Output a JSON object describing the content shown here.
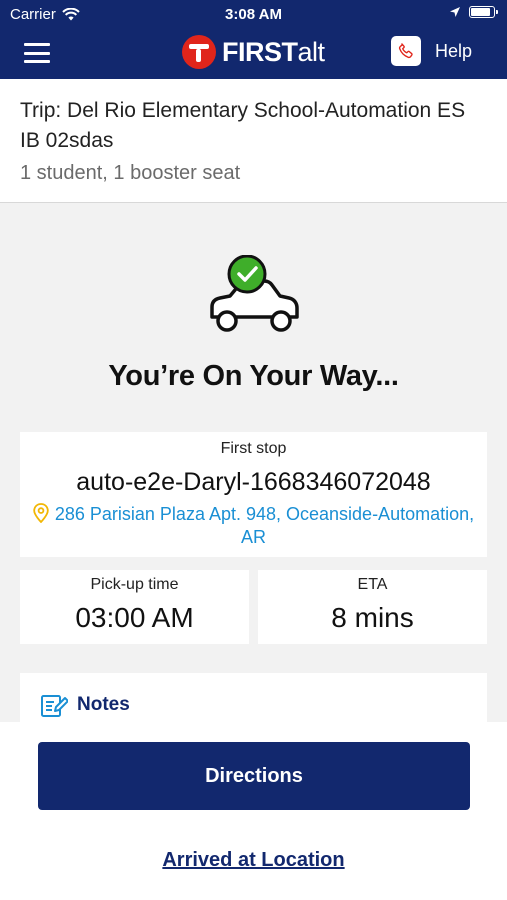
{
  "status_bar": {
    "carrier": "Carrier",
    "time": "3:08 AM"
  },
  "nav": {
    "brand_first": "FIRST",
    "brand_alt": "alt",
    "help_label": "Help",
    "brand_color": "#e0251b",
    "bar_color": "#12286e"
  },
  "trip": {
    "title": "Trip: Del Rio Elementary School-Automation ES IB 02sdas",
    "subtitle": "1 student, 1 booster seat"
  },
  "hero": {
    "icon": "car-with-checkmark-icon",
    "title": "You’re On Your Way..."
  },
  "first_stop": {
    "caption": "First stop",
    "name": "auto-e2e-Daryl-1668346072048",
    "address": "286 Parisian Plaza Apt. 948, Oceanside-Automation, AR"
  },
  "pickup": {
    "caption": "Pick-up time",
    "value": "03:00 AM"
  },
  "eta": {
    "caption": "ETA",
    "value": "8 mins"
  },
  "notes": {
    "label": "Notes"
  },
  "actions": {
    "directions_label": "Directions",
    "arrived_label": "Arrived at Location"
  }
}
